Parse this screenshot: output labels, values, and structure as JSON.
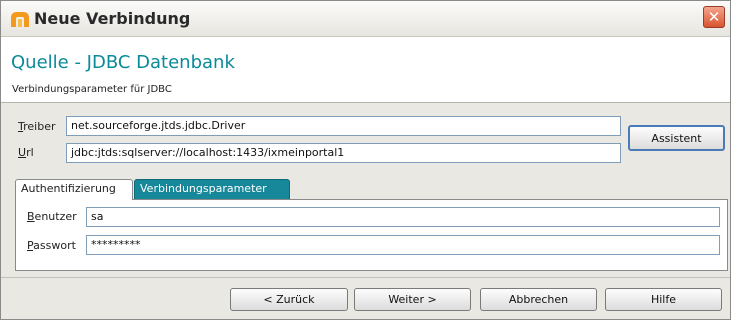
{
  "window": {
    "title": "Neue Verbindung",
    "close_label": "✕"
  },
  "header": {
    "title": "Quelle - JDBC Datenbank",
    "subtitle": "Verbindungsparameter für JDBC"
  },
  "form": {
    "treiber_label_key": "T",
    "treiber_label_rest": "reiber",
    "treiber_value": "net.sourceforge.jtds.jdbc.Driver",
    "url_label_key": "U",
    "url_label_rest": "rl",
    "url_value": "jdbc:jtds:sqlserver://localhost:1433/ixmeinportal1",
    "assistent_label": "Assistent"
  },
  "tabs": [
    {
      "label": "Authentifizierung",
      "active": true
    },
    {
      "label": "Verbindungsparameter",
      "active": false
    }
  ],
  "auth": {
    "benutzer_label_key": "B",
    "benutzer_label_rest": "enutzer",
    "benutzer_value": "sa",
    "passwort_label_key": "P",
    "passwort_label_rest": "asswort",
    "passwort_value": "*********"
  },
  "buttons": {
    "back": "< Zurück",
    "next": "Weiter >",
    "cancel": "Abbrechen",
    "help": "Hilfe"
  },
  "colors": {
    "accent": "#0b8a9a",
    "tab_inactive": "#17879a",
    "close": "#d9542f"
  },
  "icons": {
    "app": "app-logo-icon",
    "close": "close-icon"
  }
}
